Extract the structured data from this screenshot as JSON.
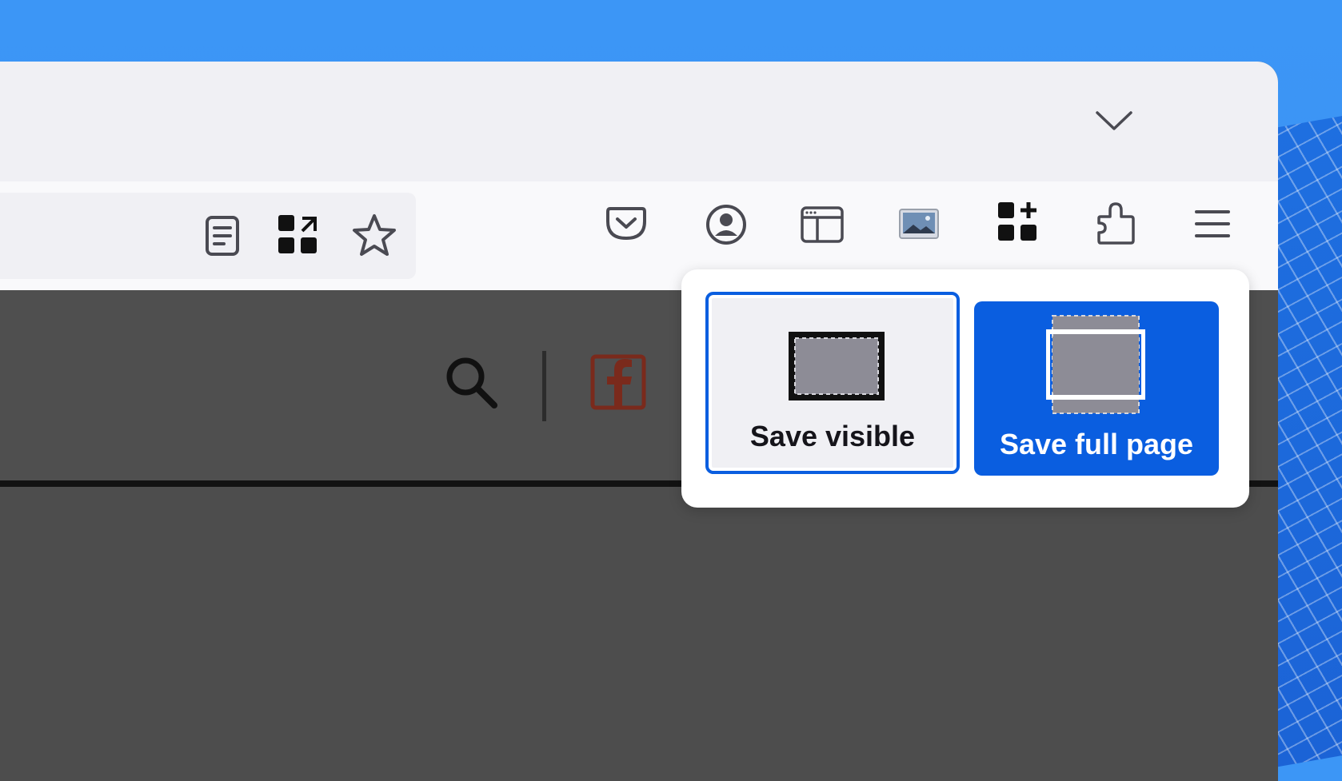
{
  "desktop": {
    "background_color": "#3c96f6"
  },
  "tabbar": {
    "list_all_tabs_icon": "chevron-down-icon"
  },
  "toolbar": {
    "url_icons": [
      "reader-view-icon",
      "share-grid-icon",
      "bookmark-star-icon"
    ],
    "icons": [
      "pocket-icon",
      "account-icon",
      "sidebar-icon",
      "screenshot-extension-icon",
      "add-ons-grid-icon",
      "extensions-puzzle-icon",
      "hamburger-menu-icon"
    ]
  },
  "site": {
    "search_icon": "search-icon",
    "social_icon": "facebook-icon"
  },
  "screenshot_panel": {
    "save_visible_label": "Save visible",
    "save_full_page_label": "Save full page",
    "accent_color": "#0a5ee0"
  }
}
